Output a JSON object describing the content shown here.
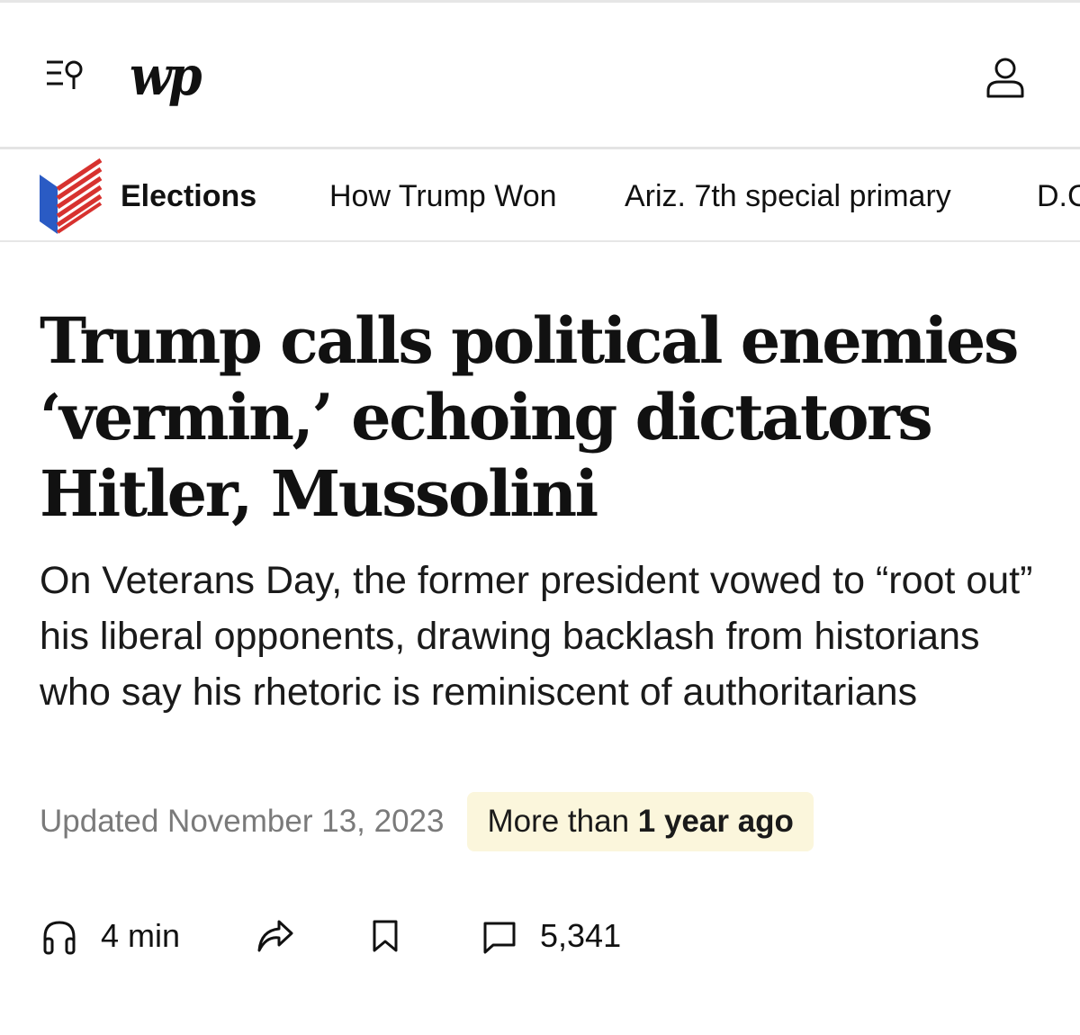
{
  "header": {
    "logo_text": "wp",
    "menu_icon": "menu-search-icon",
    "account_icon": "user-icon"
  },
  "section_nav": {
    "icon": "elections-flag-icon",
    "colors": {
      "red": "#d7322f",
      "blue": "#2a5bc4"
    },
    "items": [
      {
        "label": "Elections"
      },
      {
        "label": "How Trump Won"
      },
      {
        "label": "Ariz. 7th special primary"
      },
      {
        "label": "D.C"
      }
    ]
  },
  "article": {
    "headline": "Trump calls political enemies ‘vermin,’ echoing dictators Hitler, Mussolini",
    "dek": "On Veterans Day, the former president vowed to “root out” his liberal opponents, drawing backlash from historians who say his rhetoric is reminiscent of authoritarians",
    "updated": "Updated November 13, 2023",
    "age_badge": {
      "prefix": "More than ",
      "emphasis": "1 year ago",
      "background": "#fbf6dc"
    }
  },
  "actions": {
    "listen": {
      "icon": "headphones-icon",
      "label": "4 min"
    },
    "share": {
      "icon": "share-icon"
    },
    "save": {
      "icon": "bookmark-icon"
    },
    "comments": {
      "icon": "comment-icon",
      "count": "5,341"
    }
  }
}
